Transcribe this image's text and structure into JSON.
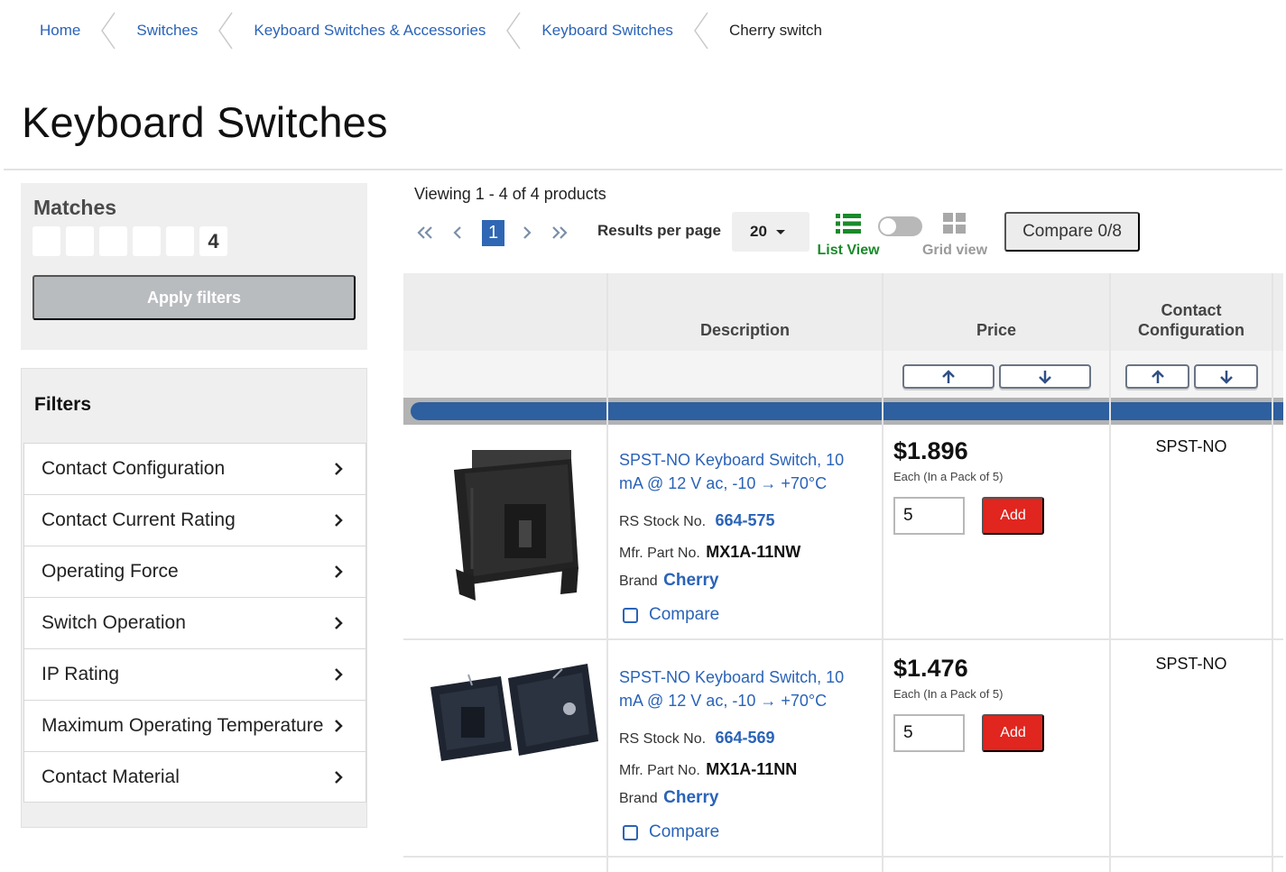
{
  "breadcrumb": [
    {
      "label": "Home"
    },
    {
      "label": "Switches"
    },
    {
      "label": "Keyboard Switches & Accessories"
    },
    {
      "label": "Keyboard Switches"
    },
    {
      "label": "Cherry switch"
    }
  ],
  "page_title": "Keyboard Switches",
  "sidebar": {
    "matches_title": "Matches",
    "match_count_digits": [
      "",
      "",
      "",
      "",
      "",
      "4"
    ],
    "apply_label": "Apply filters",
    "filters_title": "Filters",
    "filters": [
      {
        "label": "Contact Configuration",
        "icon": "chevron-right-icon"
      },
      {
        "label": "Contact Current Rating",
        "icon": "chevron-right-icon"
      },
      {
        "label": "Operating Force",
        "icon": "chevron-right-icon"
      },
      {
        "label": "Switch Operation",
        "icon": "chevron-right-icon"
      },
      {
        "label": "IP Rating",
        "icon": "chevron-right-icon"
      },
      {
        "label": "Maximum Operating Temperature",
        "icon": "chevron-right-icon"
      },
      {
        "label": "Contact Material",
        "icon": "chevron-right-icon"
      }
    ]
  },
  "toolbar": {
    "viewing_text": "Viewing 1 - 4 of 4 products",
    "current_page": "1",
    "results_per_page_label": "Results per page",
    "results_per_page_value": "20",
    "list_view_label": "List View",
    "grid_view_label": "Grid view",
    "compare_label": "Compare 0/8"
  },
  "table": {
    "headers": {
      "description": "Description",
      "price": "Price",
      "contact_config_line1": "Contact",
      "contact_config_line2": "Configuration"
    },
    "rows": [
      {
        "description": "SPST-NO Keyboard Switch, 10 mA @ 12 V ac, -10 → +70°C",
        "stock_label": "RS Stock No.",
        "stock_no": "664-575",
        "mfr_label": "Mfr. Part No.",
        "mfr_no": "MX1A-11NW",
        "brand_label": "Brand",
        "brand": "Cherry",
        "compare_label": "Compare",
        "price": "$1.896",
        "price_unit": "Each (In a Pack of 5)",
        "quantity": "5",
        "add_label": "Add",
        "contact_configuration": "SPST-NO"
      },
      {
        "description": "SPST-NO Keyboard Switch, 10 mA @ 12 V ac, -10 → +70°C",
        "stock_label": "RS Stock No.",
        "stock_no": "664-569",
        "mfr_label": "Mfr. Part No.",
        "mfr_no": "MX1A-11NN",
        "brand_label": "Brand",
        "brand": "Cherry",
        "compare_label": "Compare",
        "price": "$1.476",
        "price_unit": "Each (In a Pack of 5)",
        "quantity": "5",
        "add_label": "Add",
        "contact_configuration": "SPST-NO"
      }
    ]
  },
  "colors": {
    "link_blue": "#2a63b8",
    "add_red": "#e0261f",
    "list_view_green": "#1a8a2a",
    "band_blue": "#2e5f9e"
  }
}
